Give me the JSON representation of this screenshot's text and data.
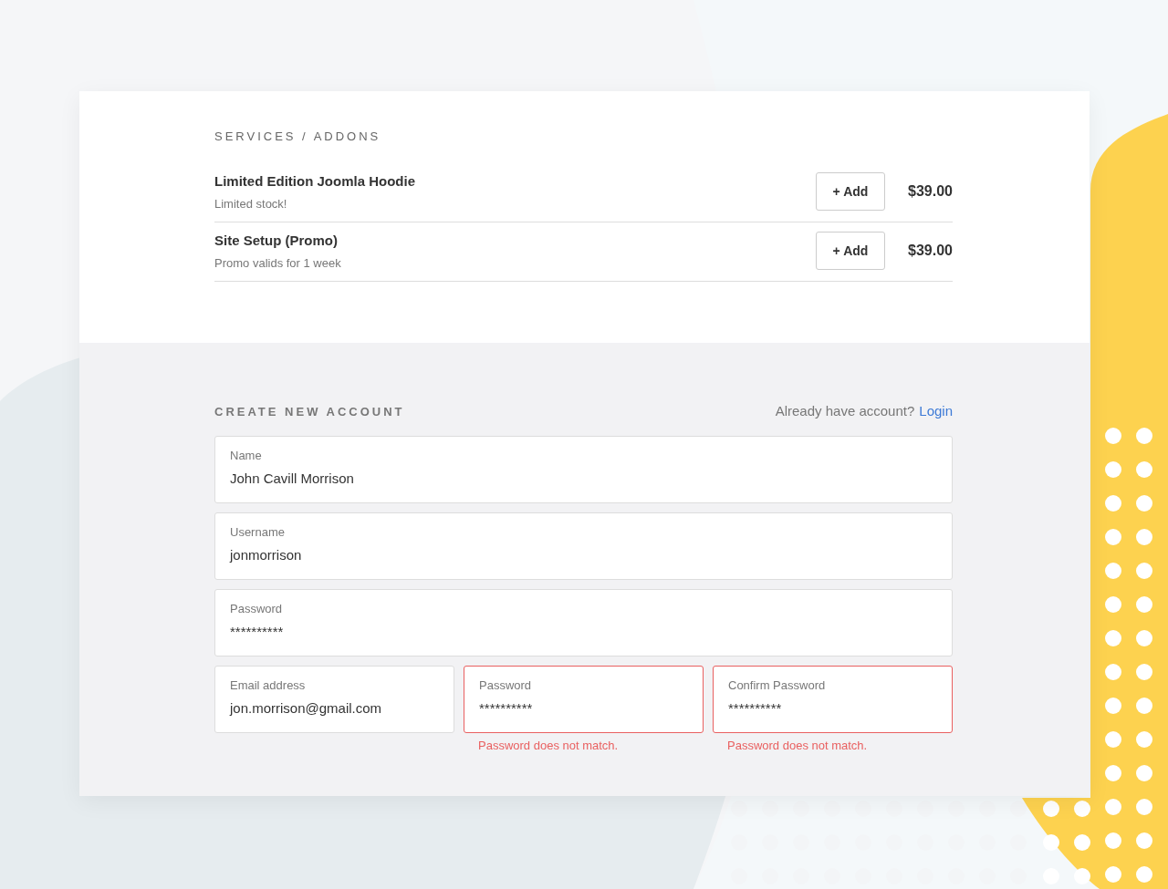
{
  "services": {
    "heading": "SERVICES / ADDONS",
    "items": [
      {
        "title": "Limited Edition Joomla Hoodie",
        "note": "Limited stock!",
        "button": "+ Add",
        "price": "$39.00"
      },
      {
        "title": "Site Setup (Promo)",
        "note": "Promo valids for 1 week",
        "button": "+ Add",
        "price": "$39.00"
      }
    ]
  },
  "account": {
    "heading": "CREATE NEW ACCOUNT",
    "login_prompt": "Already have account?",
    "login_link": "Login",
    "rows": [
      [
        {
          "label": "Name",
          "value": "John Cavill Morrison",
          "invalid": false
        }
      ],
      [
        {
          "label": "Username",
          "value": "jonmorrison",
          "invalid": false
        }
      ],
      [
        {
          "label": "Password",
          "value": "**********",
          "invalid": false
        }
      ],
      [
        {
          "label": "Email address",
          "value": "jon.morrison@gmail.com",
          "invalid": false
        },
        {
          "label": "Password",
          "value": "**********",
          "invalid": true,
          "error": "Password does not match."
        },
        {
          "label": "Confirm Password",
          "value": "**********",
          "invalid": true,
          "error": "Password does not match."
        }
      ]
    ]
  }
}
